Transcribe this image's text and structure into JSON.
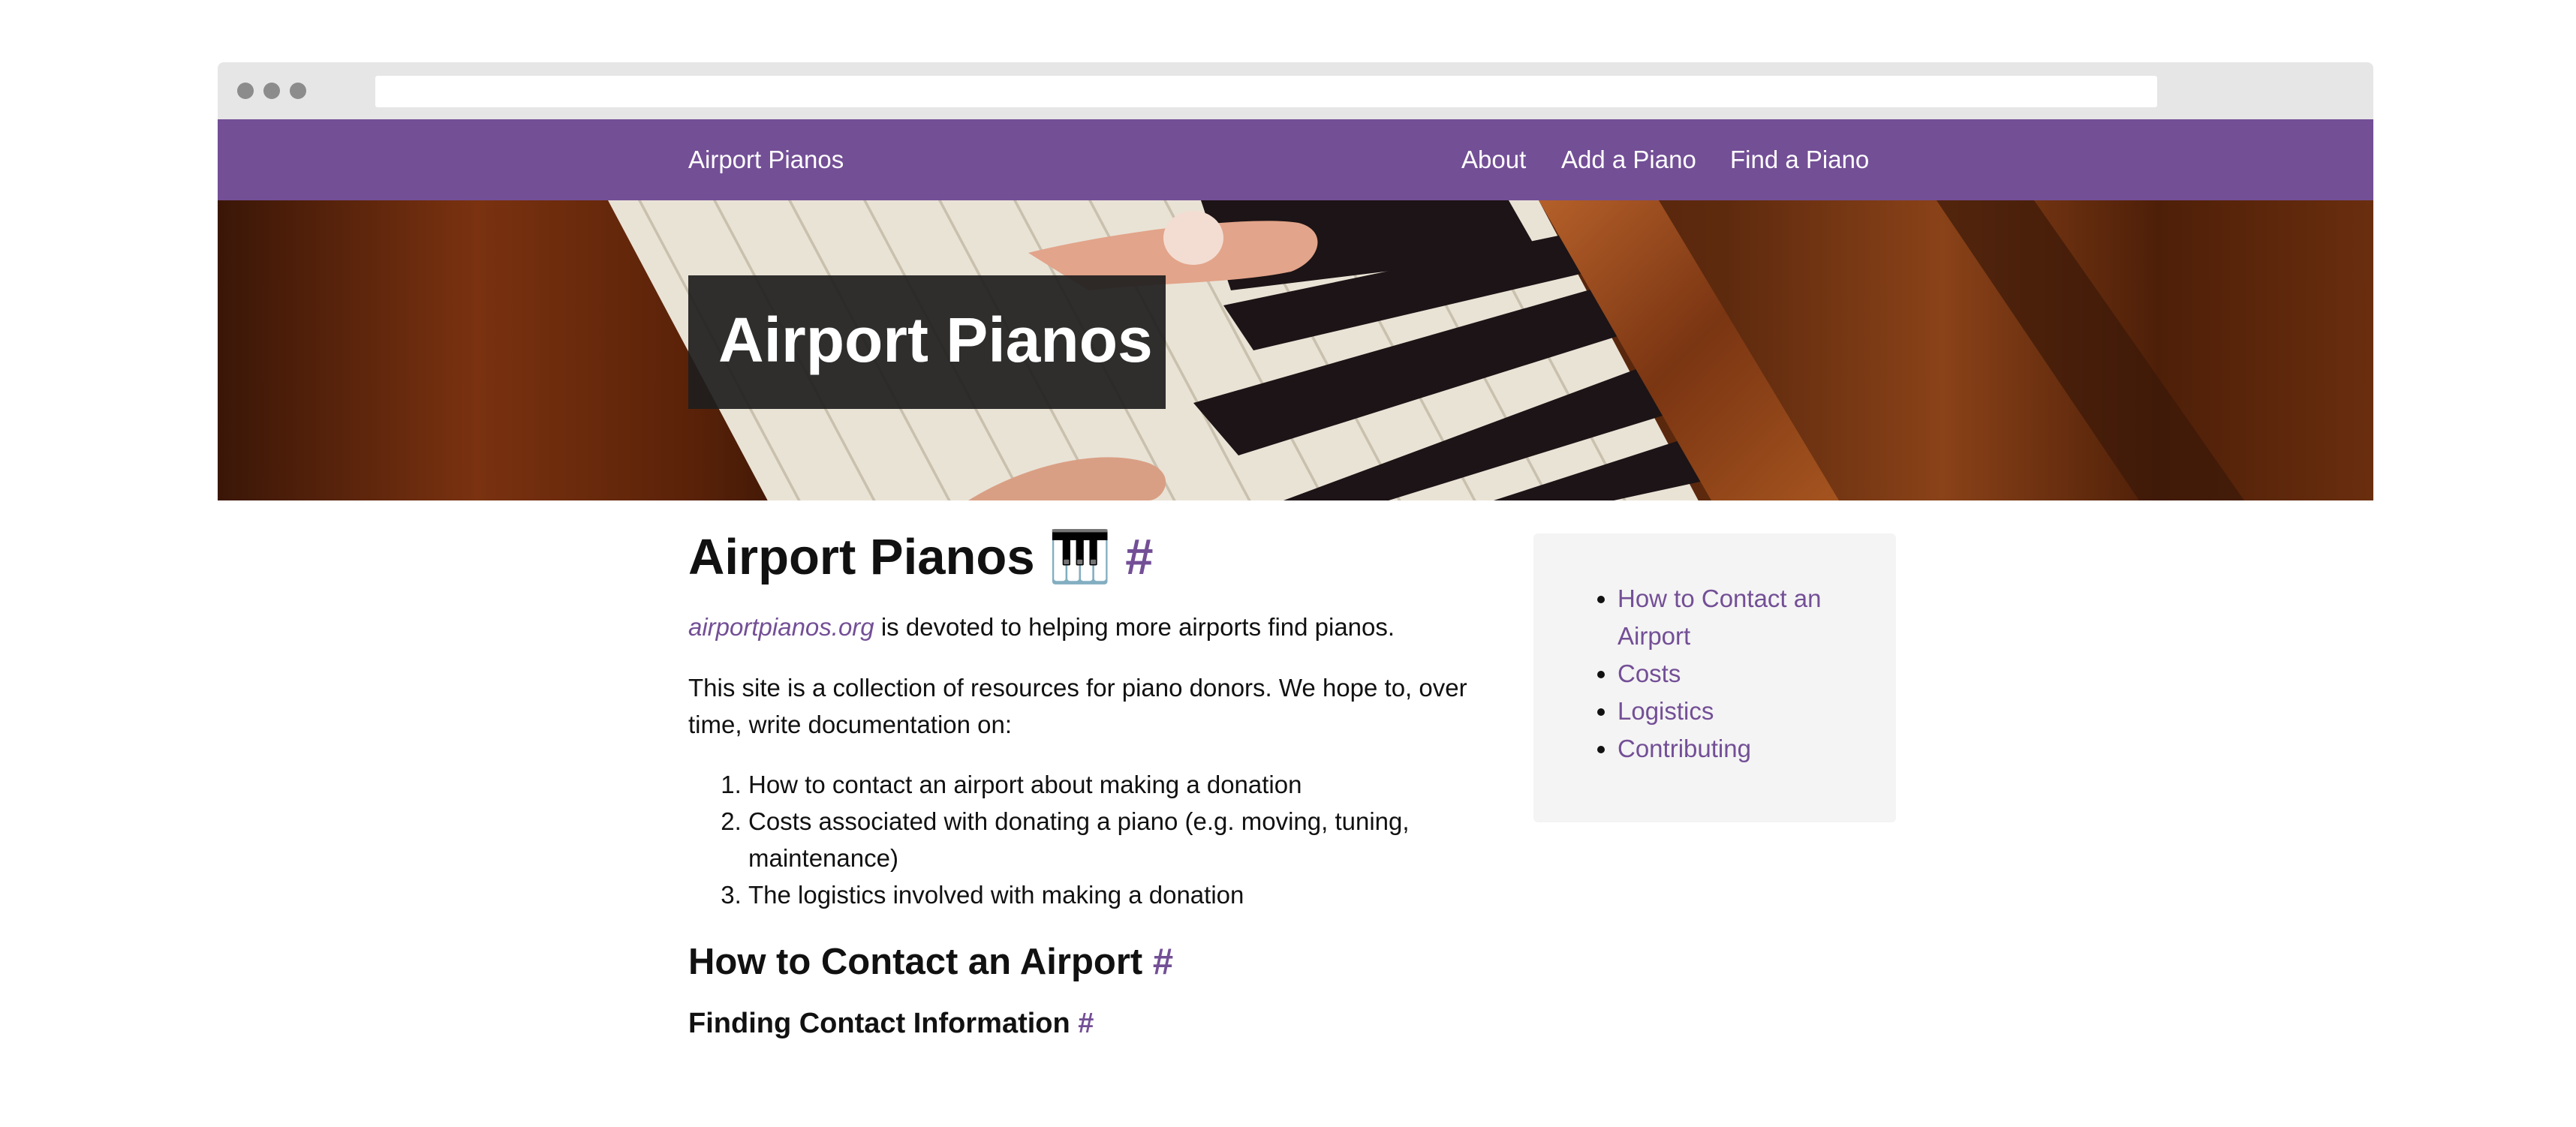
{
  "navbar": {
    "brand": "Airport Pianos",
    "links": [
      "About",
      "Add a Piano",
      "Find a Piano"
    ]
  },
  "hero": {
    "title": "Airport Pianos"
  },
  "content": {
    "title": "Airport Pianos",
    "title_emoji": "🎹",
    "anchor": "#",
    "intro_link": "airportpianos.org",
    "intro_rest": " is devoted to helping more airports find pianos.",
    "paragraph": "This site is a collection of resources for piano donors. We hope to, over time, write documentation on:",
    "list": [
      "How to contact an airport about making a donation",
      "Costs associated with donating a piano (e.g. moving, tuning, maintenance)",
      "The logistics involved with making a donation"
    ],
    "section_heading": "How to Contact an Airport",
    "subsection_heading": "Finding Contact Information"
  },
  "toc": {
    "items": [
      "How to Contact an Airport",
      "Costs",
      "Logistics",
      "Contributing"
    ]
  },
  "colors": {
    "accent": "#734f96",
    "chrome": "#e6e6e6",
    "toc_bg": "#f4f4f4"
  }
}
